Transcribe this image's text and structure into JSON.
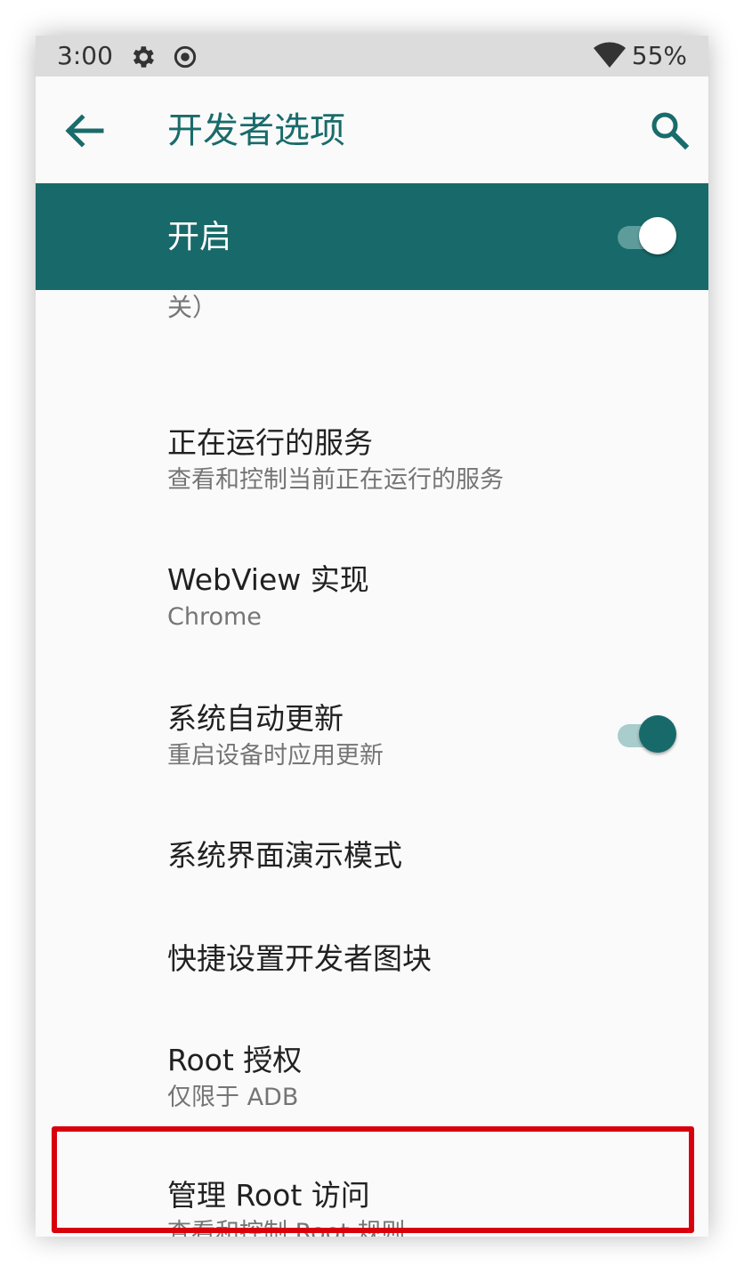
{
  "status_bar": {
    "time": "3:00",
    "battery": "55%",
    "icons": [
      "settings-gear-icon",
      "radio-target-icon",
      "wifi-icon"
    ]
  },
  "app_bar": {
    "title": "开发者选项",
    "back_icon": "arrow-back-icon",
    "search_icon": "search-icon"
  },
  "master_switch": {
    "label": "开启",
    "checked": true
  },
  "partial_item": {
    "summary_tail": "关）"
  },
  "preferences": [
    {
      "title": "正在运行的服务",
      "summary": "查看和控制当前正在运行的服务"
    },
    {
      "title": "WebView 实现",
      "summary": "Chrome"
    },
    {
      "title": "系统自动更新",
      "summary": "重启设备时应用更新",
      "toggle": true
    },
    {
      "title": "系统界面演示模式",
      "summary": ""
    },
    {
      "title": "快捷设置开发者图块",
      "summary": ""
    },
    {
      "title": "Root 授权",
      "summary": "仅限于 ADB"
    },
    {
      "title": "管理 Root 访问",
      "summary": "查看和控制 Root 规则"
    }
  ],
  "colors": {
    "accent": "#186a6a",
    "title_teal": "#1a6b6b",
    "highlight_red": "#d9000d"
  }
}
